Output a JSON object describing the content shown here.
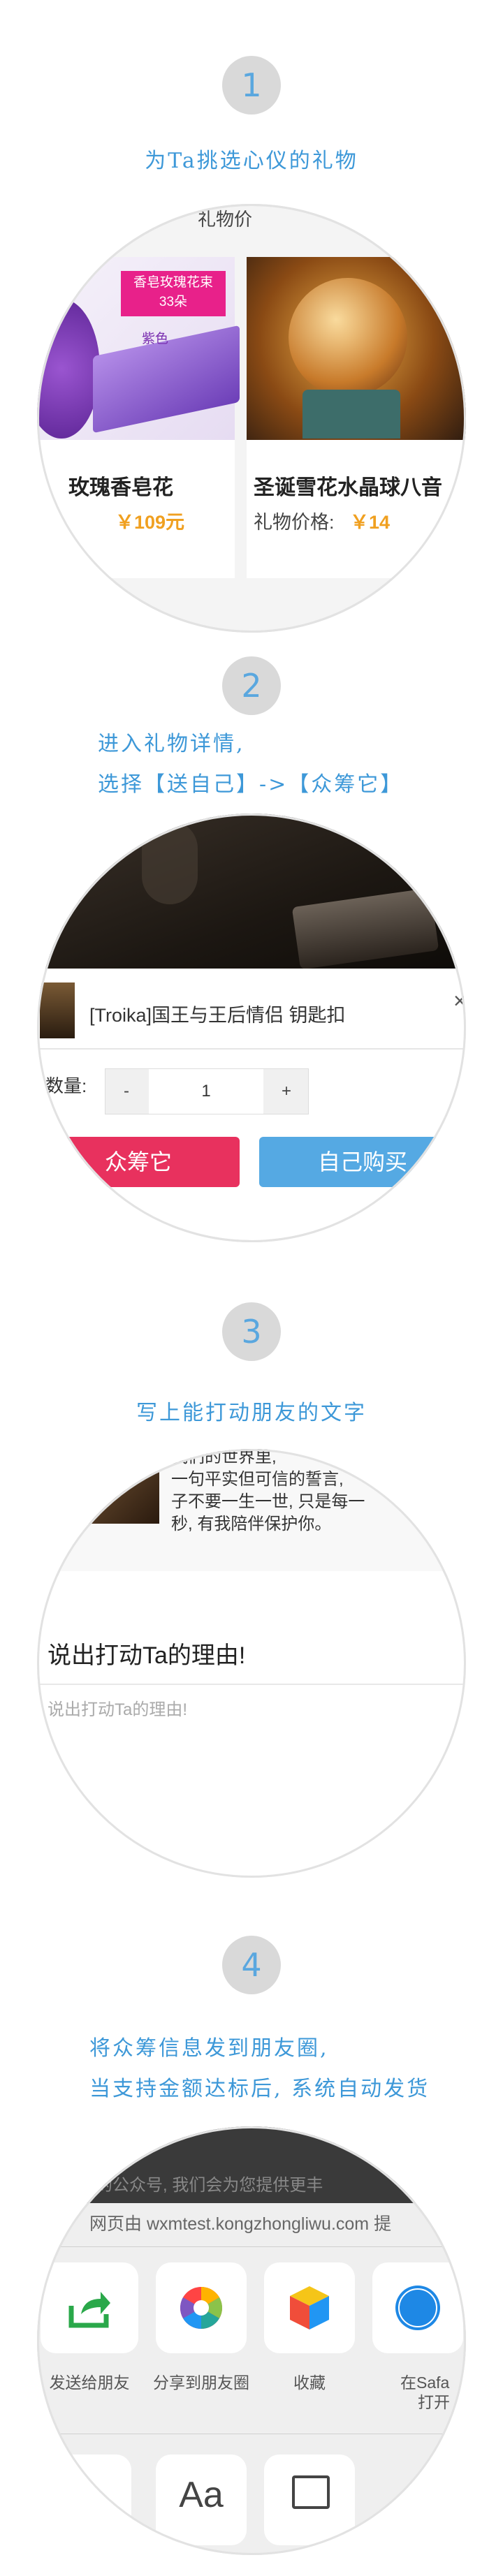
{
  "steps": [
    {
      "number": "1",
      "caption_lines": [
        "为Ta挑选心仪的礼物"
      ]
    },
    {
      "number": "2",
      "caption_lines": [
        "进入礼物详情,",
        "选择【送自己】->【众筹它】"
      ]
    },
    {
      "number": "3",
      "caption_lines": [
        "写上能打动朋友的文字"
      ]
    },
    {
      "number": "4",
      "caption_lines": [
        "将众筹信息发到朋友圈,",
        "当支持金额达标后, 系统自动发货"
      ]
    }
  ],
  "s1": {
    "top_label": "礼物价",
    "left_card": {
      "box_title": "香皂玫瑰花束",
      "box_sub": "33朵",
      "color_tag": "紫色",
      "name": "玫瑰香皂花",
      "price": "￥109元"
    },
    "right_card": {
      "name": "圣诞雪花水晶球八音",
      "price_label": "礼物价格:",
      "price": "￥14"
    }
  },
  "s2": {
    "product_name": "[Troika]国王与王后情侣 钥匙扣",
    "close": "×",
    "qty_label": "数量:",
    "minus": "-",
    "qty_value": "1",
    "plus": "+",
    "crowdfund_btn": "众筹它",
    "buy_btn": "自己购买"
  },
  "s3": {
    "poem_line0": "我们的世界里,",
    "poem_line1": "一句平实但可信的誓言,",
    "poem_line2": "子不要一生一世, 只是每一",
    "poem_line3": "秒, 有我陪伴保护你。",
    "reason_title": "说出打动Ta的理由!",
    "reason_placeholder": "说出打动Ta的理由!"
  },
  "s4": {
    "top_text": "们的公众号, 我们会为您提供更丰",
    "source": "网页由 wxmtest.kongzhongliwu.com 提",
    "share_items": [
      {
        "label": "发送给朋友",
        "icon": "share-arrow-icon"
      },
      {
        "label": "分享到朋友圈",
        "icon": "moments-icon"
      },
      {
        "label": "收藏",
        "icon": "favorite-cube-icon"
      },
      {
        "label": "在Safa",
        "label2": "打开",
        "icon": "safari-icon"
      }
    ],
    "bottom_icon_text": "Aa"
  },
  "colors": {
    "accent_blue": "#3d98d8",
    "crowdfund": "#e8315e",
    "buy": "#55a9e3",
    "price": "#f0a020"
  }
}
